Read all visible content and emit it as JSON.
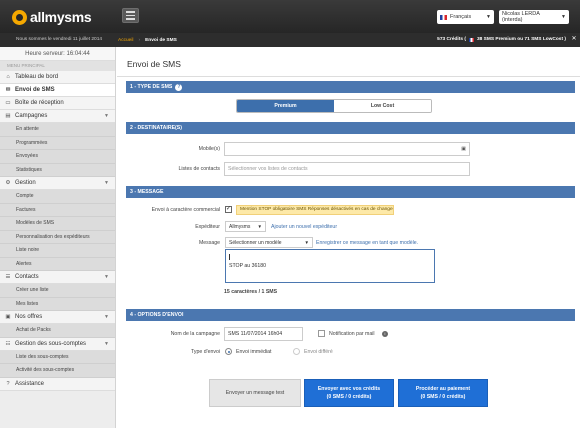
{
  "header": {
    "brand": "allmysms",
    "language": "Français",
    "user": "Nicolas LERDA (interda)"
  },
  "subheader": {
    "date_text": "Nous sommes le vendredi 11 juillet 2014",
    "breadcrumb_home": "Accueil",
    "breadcrumb_current": "Envoi de SMS",
    "credits_count": "573 Crédits (",
    "credits_detail": "38 SMS Premium ou 71 SMS LowCost )"
  },
  "sidebar": {
    "server_time": "Heure serveur: 16:04:44",
    "menu_title": "MENU PRINCIPAL",
    "dashboard": "Tableau de bord",
    "send_sms": "Envoi de SMS",
    "inbox": "Boîte de réception",
    "campaigns": "Campagnes",
    "campaign_items": [
      "En attente",
      "Programmées",
      "Envoyées",
      "Statistiques"
    ],
    "management": "Gestion",
    "management_items": [
      "Compte",
      "Factures",
      "Modèles de SMS",
      "Personnalisation des expéditeurs",
      "Liste noire",
      "Alertes"
    ],
    "contacts": "Contacts",
    "contacts_items": [
      "Créer une liste",
      "Mes listes"
    ],
    "offers": "Nos offres",
    "offers_items": [
      "Achat de Packs"
    ],
    "subaccounts": "Gestion des sous-comptes",
    "subaccounts_items": [
      "Liste des sous-comptes",
      "Activité des sous-comptes"
    ],
    "assistance": "Assistance"
  },
  "main": {
    "title": "Envoi de SMS",
    "sec1": "1 - TYPE DE SMS",
    "type_premium": "Premium",
    "type_lowcost": "Low Cost",
    "sec2": "2 - DESTINATAIRE(S)",
    "mobile_label": "Mobile(s)",
    "lists_label": "Listes de contacts",
    "lists_placeholder": "Sélectionner vos listes de contacts",
    "sec3": "3 - MESSAGE",
    "commercial_label": "Envoi à caractère commercial",
    "commercial_warning": "Mention STOP obligatoire SMS Réponses désactivés en cas de changement d'expéditeur.",
    "sender_label": "Expéditeur",
    "sender_value": "Allmysms",
    "add_sender": "Ajouter un nouvel expéditeur",
    "message_label": "Message",
    "template_value": "Sélectionner un modèle",
    "save_template": "Enregistrer ce message en tant que modèle.",
    "message_text": "STOP au 36180",
    "char_count": "15 caractères / 1 SMS",
    "sec4": "4 - OPTIONS D'ENVOI",
    "campaign_name_label": "Nom de la campagne",
    "campaign_name_value": "SMS 11/07/2014  16h04",
    "email_notif": "Notification par mail",
    "send_type_label": "Type d'envoi",
    "send_now": "Envoi immédiat",
    "send_later": "Envoi différé",
    "btn_test": "Envoyer un message test",
    "btn_send_l1": "Envoyer avec vos crédits",
    "btn_send_l2": "(0 SMS / 0 crédits)",
    "btn_pay_l1": "Procéder au paiement",
    "btn_pay_l2": "(0 SMS / 0 crédits)"
  }
}
